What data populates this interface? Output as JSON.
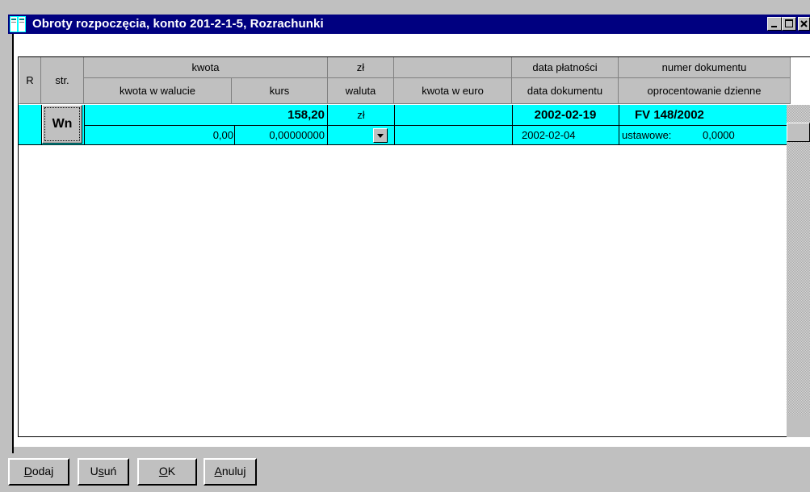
{
  "window": {
    "title": "Obroty rozpoczęcia, konto 201-2-1-5, Rozrachunki"
  },
  "headers": {
    "r": "R",
    "str": "str.",
    "kwota": "kwota",
    "zl": "zł",
    "data_platnosci": "data płatności",
    "numer_dokumentu": "numer dokumentu",
    "kwota_w_walucie": "kwota w walucie",
    "kurs": "kurs",
    "waluta": "waluta",
    "kwota_w_euro": "kwota w euro",
    "data_dokumentu": "data dokumentu",
    "oprocentowanie_dzienne": "oprocentowanie dzienne"
  },
  "row": {
    "str": "Wn",
    "kwota": "158,20",
    "zl": "zł",
    "data_platnosci": "2002-02-19",
    "numer_dokumentu": "FV 148/2002",
    "kwota_w_walucie": "0,00",
    "kurs": "0,00000000",
    "waluta": "",
    "kwota_w_euro": "",
    "data_dokumentu": "2002-02-04",
    "oprocentowanie_label": "ustawowe:",
    "oprocentowanie_value": "0,0000"
  },
  "buttons": {
    "dodaj_pre": "",
    "dodaj_ul": "D",
    "dodaj_post": "odaj",
    "usun_pre": "U",
    "usun_ul": "s",
    "usun_post": "uń",
    "ok_pre": "",
    "ok_ul": "O",
    "ok_post": "K",
    "anuluj_pre": "",
    "anuluj_ul": "A",
    "anuluj_post": "nuluj"
  },
  "colors": {
    "titlebar": "#000080",
    "selected_row": "#00ffff",
    "face": "#c0c0c0"
  },
  "icons": [
    "app-icon",
    "minimize-icon",
    "maximize-icon",
    "close-icon",
    "dropdown-arrow-icon"
  ]
}
